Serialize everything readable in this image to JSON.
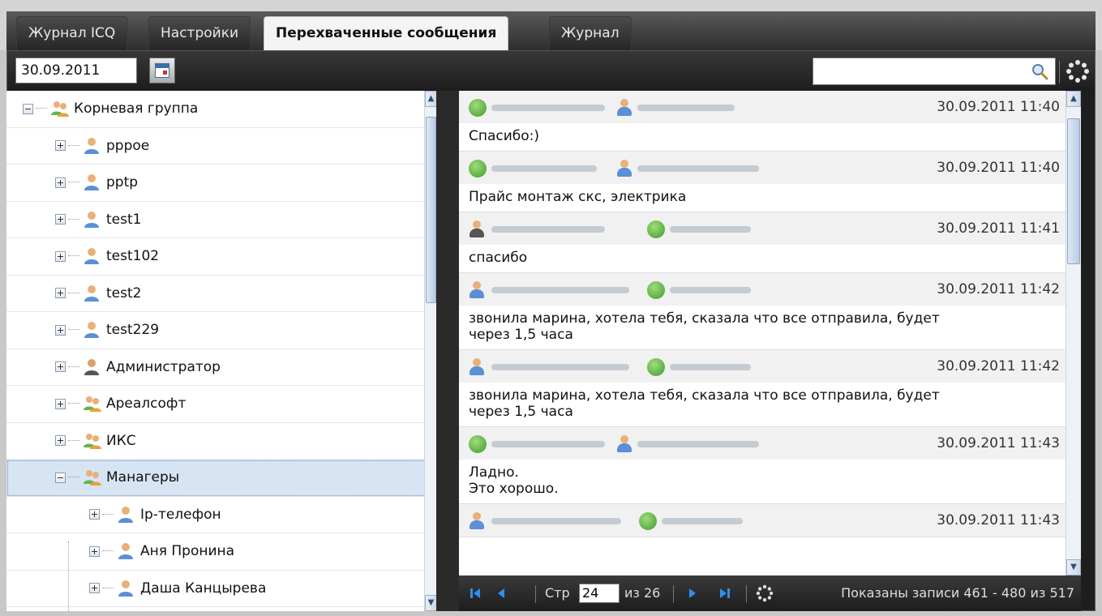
{
  "tabs": [
    {
      "label": "Журнал ICQ",
      "active": false
    },
    {
      "label": "Настройки",
      "active": false
    },
    {
      "label": "Перехваченные сообщения",
      "active": true
    },
    {
      "label": "Журнал",
      "active": false
    }
  ],
  "toolbar": {
    "date_value": "30.09.2011",
    "search_value": ""
  },
  "tree": {
    "root": {
      "label": "Корневая группа",
      "expanded": true,
      "icon": "group-icon"
    },
    "items": [
      {
        "label": "pppoe",
        "icon": "user-icon"
      },
      {
        "label": "pptp",
        "icon": "user-icon"
      },
      {
        "label": "test1",
        "icon": "user-icon"
      },
      {
        "label": "test102",
        "icon": "user-icon"
      },
      {
        "label": "test2",
        "icon": "user-icon"
      },
      {
        "label": "test229",
        "icon": "user-icon"
      },
      {
        "label": "Администратор",
        "icon": "admin-icon"
      },
      {
        "label": "Ареалсофт",
        "icon": "group-icon"
      },
      {
        "label": "ИКС",
        "icon": "group-icon"
      },
      {
        "label": "Манагеры",
        "icon": "group-icon",
        "expanded": true,
        "selected": true
      }
    ],
    "children": [
      {
        "label": "Ip-телефон",
        "icon": "user-icon"
      },
      {
        "label": "Аня Пронина",
        "icon": "user-icon"
      },
      {
        "label": "Даша Канцырева",
        "icon": "user-icon"
      }
    ]
  },
  "messages": [
    {
      "timestamp": "30.09.2011 11:40",
      "text": "Спасибо:)"
    },
    {
      "timestamp": "30.09.2011 11:40",
      "text": "Прайс монтаж скс, электрика"
    },
    {
      "timestamp": "30.09.2011 11:41",
      "text": "спасибо"
    },
    {
      "timestamp": "30.09.2011 11:42",
      "text": "звонила марина, хотела тебя, сказала что все отправила, будет\nчерез 1,5 часа"
    },
    {
      "timestamp": "30.09.2011 11:42",
      "text": "звонила марина, хотела тебя, сказала что все отправила, будет\nчерез 1,5 часа"
    },
    {
      "timestamp": "30.09.2011 11:43",
      "text": "Ладно.\nЭто хорошо."
    },
    {
      "timestamp": "30.09.2011 11:43",
      "text": ""
    }
  ],
  "pager": {
    "page_label": "Стр",
    "page_value": "24",
    "of_label": "из 26",
    "status": "Показаны записи 461 - 480 из 517"
  },
  "colors": {
    "toolbar_dark": "#1e1e1e",
    "selection": "#d7e4f3",
    "accent_blue": "#2f6fcf"
  }
}
